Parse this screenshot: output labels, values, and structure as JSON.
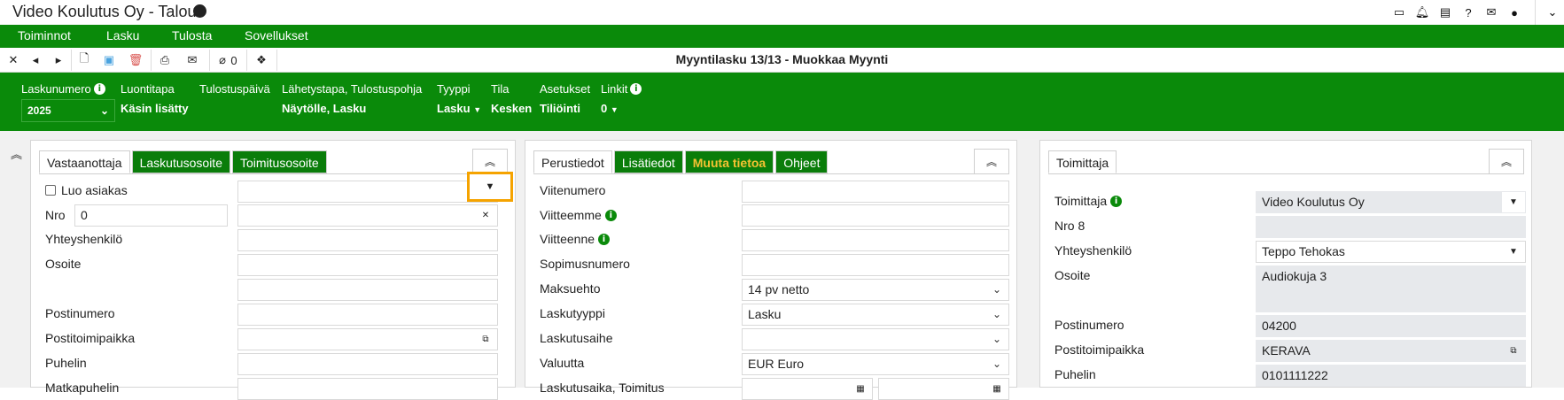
{
  "app": {
    "title": "Video Koulutus Oy - Talous"
  },
  "topbar_icons": [
    "window-icon",
    "bell-icon",
    "news-icon",
    "help-icon",
    "mail-icon",
    "user-icon",
    "double-chevron-down-icon"
  ],
  "menu": [
    "Toiminnot",
    "Lasku",
    "Tulosta",
    "Sovellukset"
  ],
  "toolbar": {
    "attachments_count": "0",
    "document_title": "Myyntilasku 13/13 - Muokkaa Myynti"
  },
  "info": {
    "laskunumero": {
      "label": "Laskunumero",
      "value": "2025"
    },
    "luontitapa": {
      "label": "Luontitapa",
      "value": "Käsin lisätty"
    },
    "tulostuspaiva": {
      "label": "Tulostuspäivä",
      "value": ""
    },
    "lahetystapa": {
      "label": "Lähetystapa, Tulostuspohja",
      "value": "Näytölle, Lasku"
    },
    "tyyppi": {
      "label": "Tyyppi",
      "value": "Lasku"
    },
    "tila": {
      "label": "Tila",
      "value": "Kesken"
    },
    "asetukset": {
      "label": "Asetukset",
      "value": "Tiliöinti"
    },
    "linkit": {
      "label": "Linkit",
      "value": "0"
    }
  },
  "panel_left": {
    "tabs": [
      "Vastaanottaja",
      "Laskutusosoite",
      "Toimitusosoite"
    ],
    "luo_asiakas": "Luo asiakas",
    "nro_label": "Nro",
    "nro_value": "0",
    "labels": [
      "Yhteyshenkilö",
      "Osoite",
      "Postinumero",
      "Postitoimipaikka",
      "Puhelin",
      "Matkapuhelin"
    ]
  },
  "panel_mid": {
    "tabs": [
      "Perustiedot",
      "Lisätiedot",
      "Muuta tietoa",
      "Ohjeet"
    ],
    "labels": [
      "Viitenumero",
      "Viitteemme",
      "Viitteenne",
      "Sopimusnumero",
      "Maksuehto",
      "Laskutyyppi",
      "Laskutusaihe",
      "Valuutta",
      "Laskutusaika, Toimitus"
    ],
    "maksuehto_value": "14 pv netto",
    "laskutyyppi_value": "Lasku",
    "valuutta_value": "EUR Euro"
  },
  "panel_right": {
    "tabs": [
      "Toimittaja"
    ],
    "toimittaja_label": "Toimittaja",
    "toimittaja_value": "Video Koulutus Oy",
    "nro_label": "Nro 8",
    "yhteyshenkilo_label": "Yhteyshenkilö",
    "yhteyshenkilo_value": "Teppo Tehokas",
    "osoite_label": "Osoite",
    "osoite_value": "Audiokuja 3",
    "postinumero_label": "Postinumero",
    "postinumero_value": "04200",
    "postitoimipaikka_label": "Postitoimipaikka",
    "postitoimipaikka_value": "KERAVA",
    "puhelin_label": "Puhelin",
    "puhelin_value": "0101111222"
  }
}
